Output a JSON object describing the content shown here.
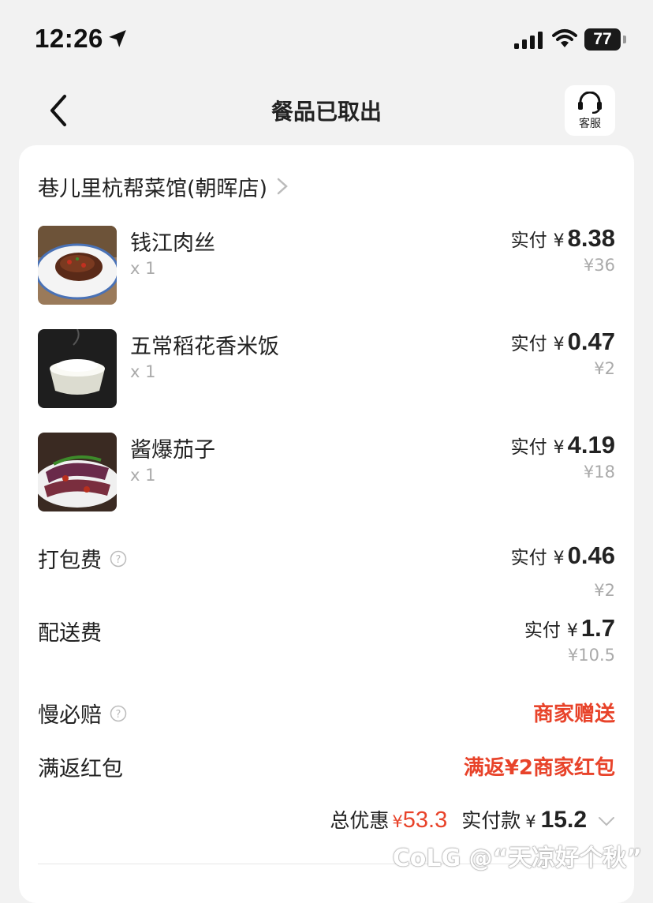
{
  "status_bar": {
    "time": "12:26",
    "battery": "77"
  },
  "nav": {
    "title": "餐品已取出",
    "service_label": "客服"
  },
  "store": {
    "name": "巷儿里杭帮菜馆(朝晖店)"
  },
  "items": [
    {
      "name": "钱江肉丝",
      "qty": "x 1",
      "pay_label": "实付",
      "yen": "¥",
      "pay": "8.38",
      "original": "¥36"
    },
    {
      "name": "五常稻花香米饭",
      "qty": "x 1",
      "pay_label": "实付",
      "yen": "¥",
      "pay": "0.47",
      "original": "¥2"
    },
    {
      "name": "酱爆茄子",
      "qty": "x 1",
      "pay_label": "实付",
      "yen": "¥",
      "pay": "4.19",
      "original": "¥18"
    }
  ],
  "fees": {
    "packing": {
      "label": "打包费",
      "pay_label": "实付",
      "yen": "¥",
      "pay": "0.46",
      "original": "¥2"
    },
    "delivery": {
      "label": "配送费",
      "pay_label": "实付",
      "yen": "¥",
      "pay": "1.7",
      "original": "¥10.5"
    },
    "late_compensation": {
      "label": "慢必赔",
      "value": "商家赠送"
    },
    "cashback": {
      "label": "满返红包",
      "value": "满返¥2商家红包"
    }
  },
  "summary": {
    "discount_label": "总优惠",
    "discount_yen": "¥",
    "discount_amount": "53.3",
    "total_label": "实付款",
    "total_yen": "¥",
    "total_amount": "15.2"
  },
  "watermark": "CoLG @“天凉好个秋”",
  "colors": {
    "accent_red": "#e8432a",
    "background": "#f2f2f2",
    "card": "#ffffff"
  }
}
